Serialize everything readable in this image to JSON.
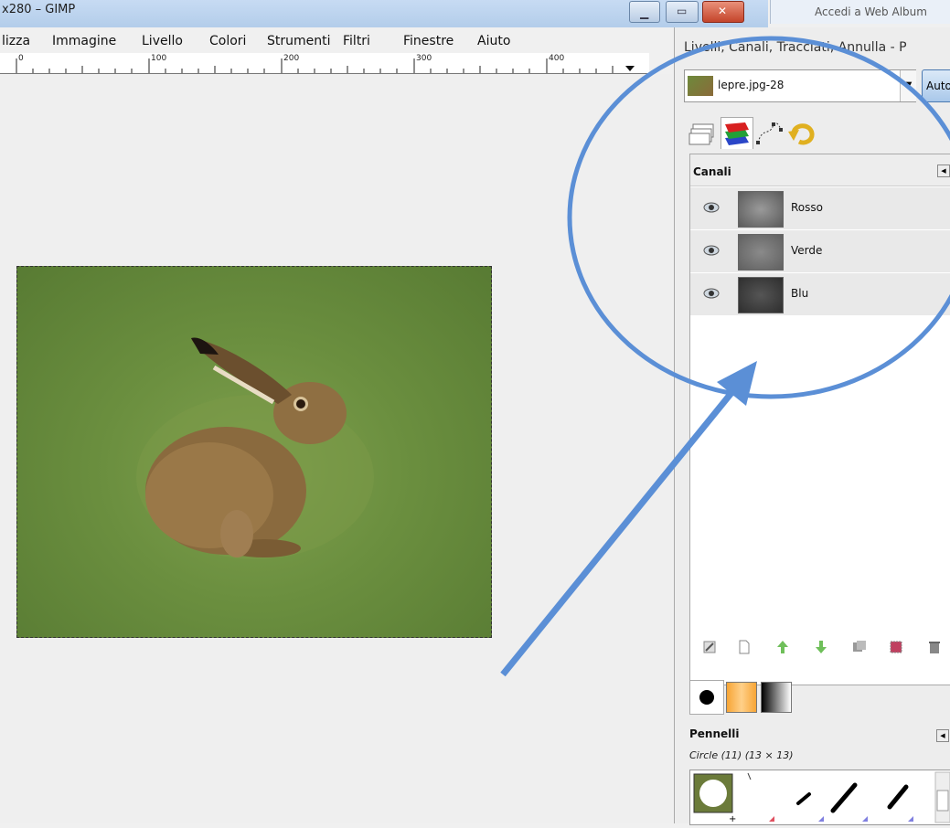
{
  "window": {
    "title": "x280 – GIMP",
    "minimize_icon": "minimize-icon",
    "maximize_icon": "maximize-icon",
    "close_icon": "close-icon"
  },
  "menu": [
    "lizza",
    "Immagine",
    "Livello",
    "Colori",
    "Strumenti",
    "Filtri",
    "Finestre",
    "Aiuto"
  ],
  "ruler": {
    "labels": [
      "0",
      "100",
      "200",
      "300",
      "400"
    ]
  },
  "background_window": {
    "label": "Accedi a Web Album"
  },
  "dock": {
    "title": "Livelli, Canali, Tracciati, Annulla - P",
    "image_select": {
      "value": "lepre.jpg-28"
    },
    "auto_button": "Auto",
    "tabs": [
      "layers-icon",
      "channels-icon",
      "paths-icon",
      "undo-history-icon"
    ],
    "channels": {
      "label": "Canali",
      "rows": [
        {
          "name": "Rosso"
        },
        {
          "name": "Verde"
        },
        {
          "name": "Blu"
        }
      ]
    },
    "channel_toolbar": [
      "edit-channel-icon",
      "new-channel-icon",
      "raise-channel-icon",
      "lower-channel-icon",
      "duplicate-channel-icon",
      "channel-to-selection-icon",
      "delete-channel-icon"
    ],
    "brushes": {
      "tabs": [
        "brushes-icon",
        "patterns-icon",
        "gradients-icon"
      ],
      "label": "Pennelli",
      "selected": "Circle (11) (13 × 13)"
    }
  },
  "colors": {
    "annotation": "#5b8fd6"
  }
}
